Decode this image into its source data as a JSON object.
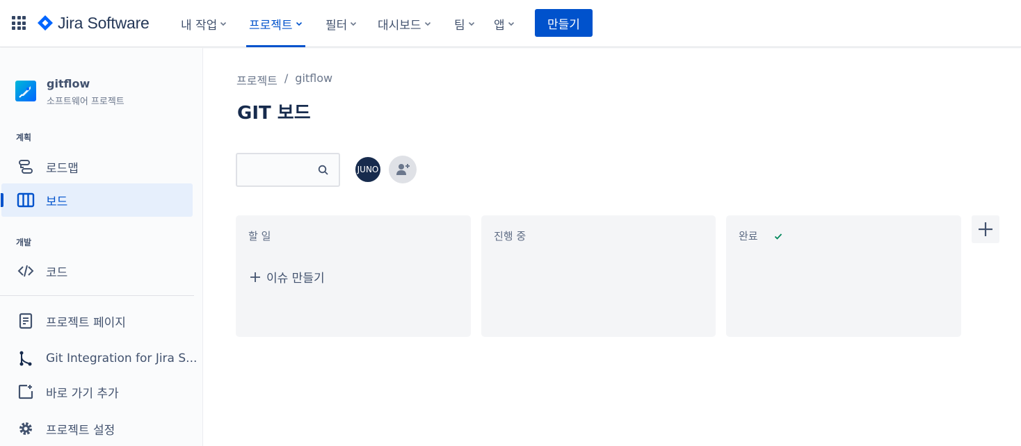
{
  "colors": {
    "primary": "#0052CC",
    "text": "#172B4D",
    "subtle": "#42526E",
    "done_check": "#00875A"
  },
  "topnav": {
    "brand": "Jira Software",
    "items": [
      {
        "label": "내 작업",
        "icon": "chevron-down-icon"
      },
      {
        "label": "프로젝트",
        "icon": "chevron-down-icon",
        "active": true
      },
      {
        "label": "필터",
        "icon": "chevron-down-icon"
      },
      {
        "label": "대시보드",
        "icon": "chevron-down-icon"
      },
      {
        "label": "팀",
        "icon": "chevron-down-icon"
      },
      {
        "label": "앱",
        "icon": "chevron-down-icon"
      }
    ],
    "create_label": "만들기"
  },
  "sidebar": {
    "project_name": "gitflow",
    "project_type": "소프트웨어 프로젝트",
    "section_plan": "계획",
    "section_dev": "개발",
    "items": [
      {
        "label": "로드맵",
        "icon": "roadmap-icon"
      },
      {
        "label": "보드",
        "icon": "board-icon",
        "selected": true
      },
      {
        "label": "코드",
        "icon": "code-icon"
      },
      {
        "label": "프로젝트 페이지",
        "icon": "page-icon"
      },
      {
        "label": "Git Integration for Jira S...",
        "icon": "git-branch-icon"
      },
      {
        "label": "바로 가기 추가",
        "icon": "add-shortcut-icon"
      },
      {
        "label": "프로젝트 설정",
        "icon": "gear-icon"
      }
    ]
  },
  "main": {
    "breadcrumb": [
      "프로젝트",
      "/",
      "gitflow"
    ],
    "title": "GIT 보드",
    "search_placeholder": "",
    "avatar_initials": "JUNO",
    "columns": [
      {
        "title": "할 일"
      },
      {
        "title": "진행 중"
      },
      {
        "title": "완료"
      }
    ],
    "create_issue_label": "이슈 만들기"
  }
}
